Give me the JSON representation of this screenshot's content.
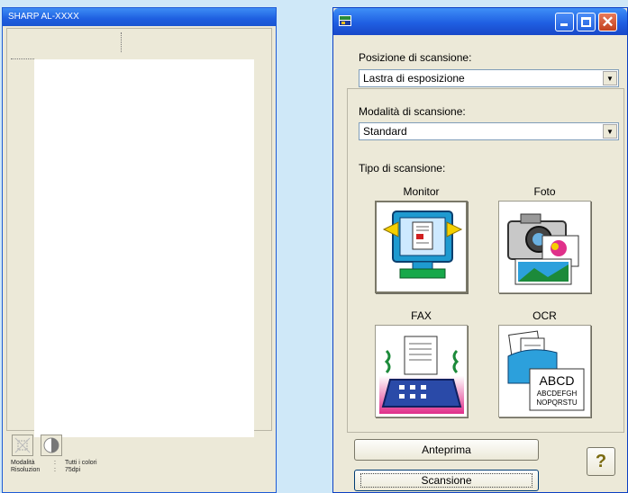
{
  "preview_window": {
    "title": "SHARP AL-XXXX",
    "info": [
      {
        "key": "Modalità",
        "value": "Tutti i colori"
      },
      {
        "key": "Risoluzion",
        "value": "75dpi"
      }
    ]
  },
  "scanner_window": {
    "position_label": "Posizione di scansione:",
    "position_value": "Lastra di esposizione",
    "mode_label": "Modalità di scansione:",
    "mode_value": "Standard",
    "type_label": "Tipo di scansione:",
    "types": [
      {
        "label": "Monitor",
        "icon": "monitor-icon",
        "selected": true
      },
      {
        "label": "Foto",
        "icon": "photo-camera-icon",
        "selected": false
      },
      {
        "label": "FAX",
        "icon": "fax-icon",
        "selected": false
      },
      {
        "label": "OCR",
        "icon": "ocr-icon",
        "selected": false
      }
    ],
    "ocr_icon_text": [
      "ABCD",
      "ABCDEFGH",
      "NOPQRSTU"
    ],
    "preview_button": "Anteprima",
    "scan_button": "Scansione",
    "help_button": "?"
  },
  "colors": {
    "desktop": "#cfe8f8",
    "titlebar": "#1f5fe2",
    "window": "#ece9d8"
  }
}
